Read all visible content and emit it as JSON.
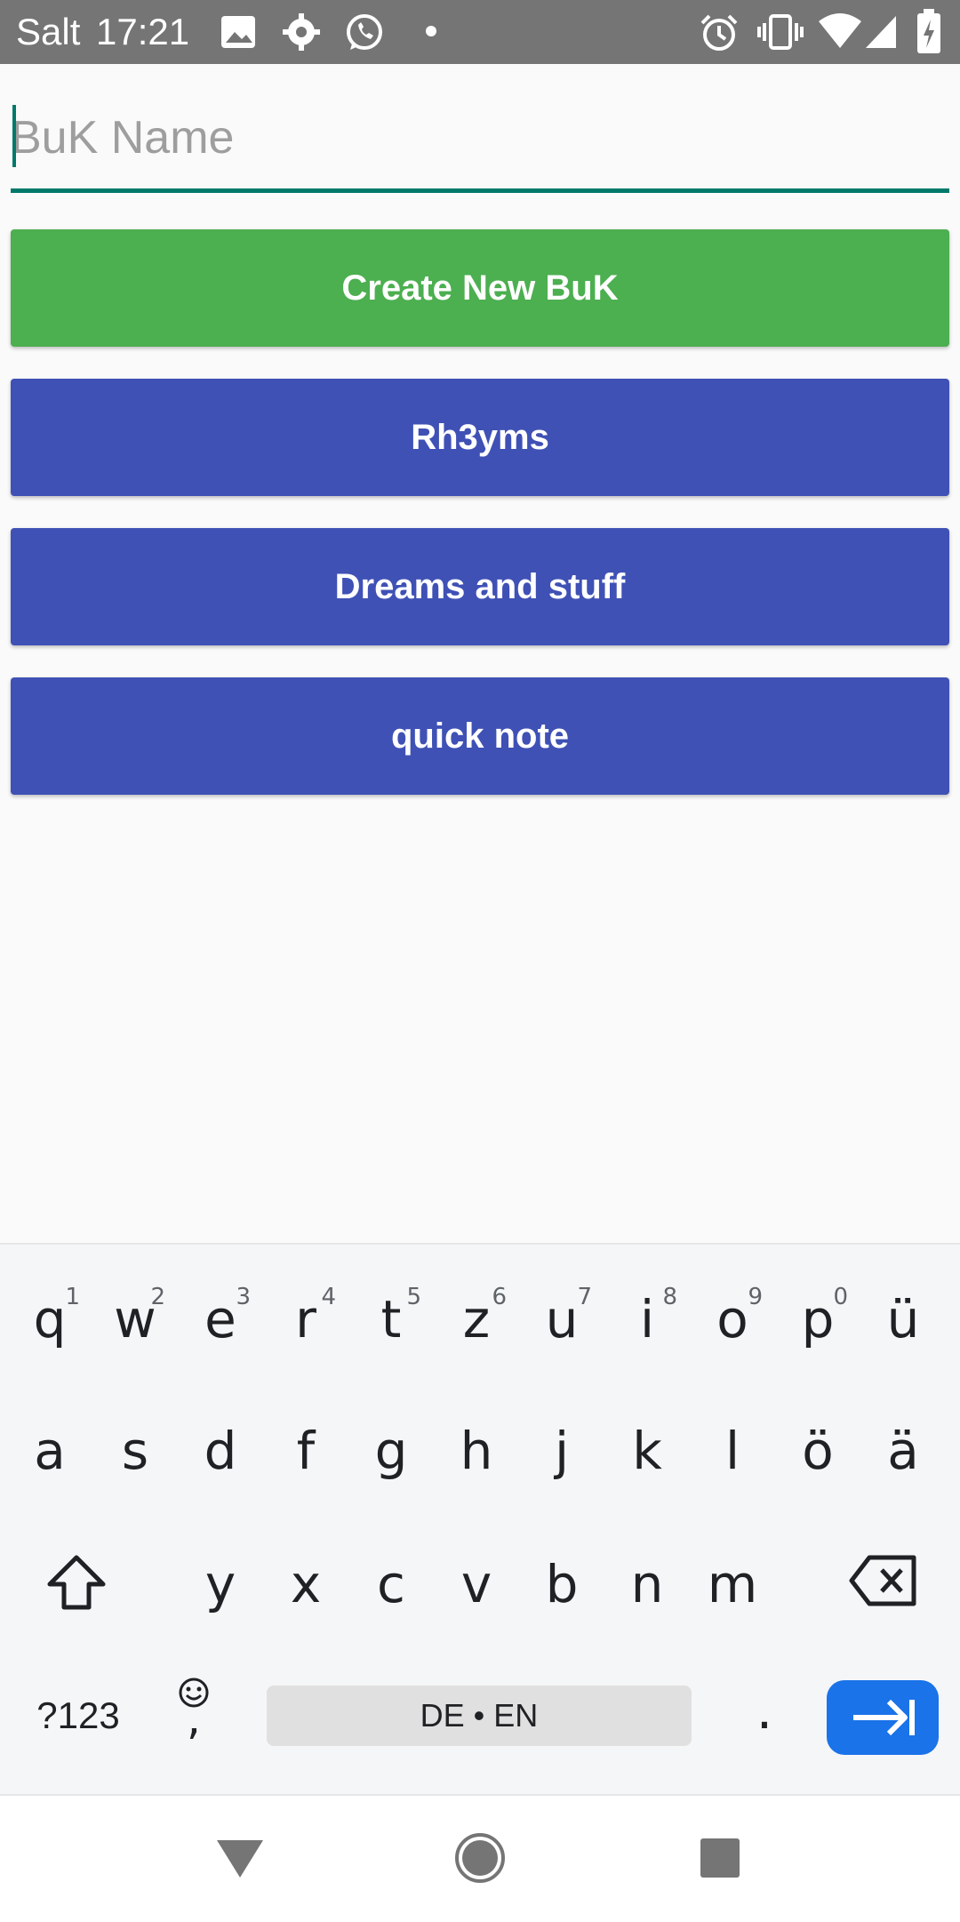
{
  "status_bar": {
    "carrier": "Salt",
    "time": "17:21",
    "icons": [
      "image-icon",
      "settings-gear-icon",
      "whatsapp-icon",
      "dot-icon",
      "alarm-icon",
      "vibrate-icon",
      "wifi-icon",
      "signal-icon",
      "battery-charging-icon"
    ]
  },
  "form": {
    "name_placeholder": "BuK Name",
    "name_value": ""
  },
  "buttons": {
    "create_label": "Create New BuK"
  },
  "buks": [
    {
      "label": "Rh3yms"
    },
    {
      "label": "Dreams and stuff"
    },
    {
      "label": "quick note"
    }
  ],
  "keyboard": {
    "row1": [
      {
        "key": "q",
        "hint": "1"
      },
      {
        "key": "w",
        "hint": "2"
      },
      {
        "key": "e",
        "hint": "3"
      },
      {
        "key": "r",
        "hint": "4"
      },
      {
        "key": "t",
        "hint": "5"
      },
      {
        "key": "z",
        "hint": "6"
      },
      {
        "key": "u",
        "hint": "7"
      },
      {
        "key": "i",
        "hint": "8"
      },
      {
        "key": "o",
        "hint": "9"
      },
      {
        "key": "p",
        "hint": "0"
      },
      {
        "key": "ü",
        "hint": ""
      }
    ],
    "row2": [
      "a",
      "s",
      "d",
      "f",
      "g",
      "h",
      "j",
      "k",
      "l",
      "ö",
      "ä"
    ],
    "row3": [
      "y",
      "x",
      "c",
      "v",
      "b",
      "n",
      "m"
    ],
    "symbols_label": "?123",
    "comma_label": ",",
    "space_label": "DE • EN",
    "period_label": ".",
    "accent_color": "#1a73e8"
  },
  "colors": {
    "create_button": "#4caf50",
    "buk_button": "#3f51b5",
    "input_accent": "#00796b",
    "status_bar": "#757575"
  }
}
